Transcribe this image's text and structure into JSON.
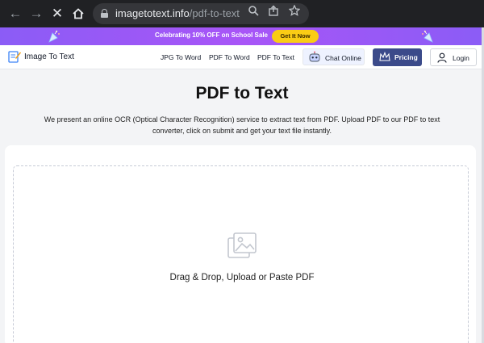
{
  "browser": {
    "url_domain": "imagetotext.info",
    "url_path": "/pdf-to-text",
    "icons": [
      "back-arrow-icon",
      "forward-arrow-icon",
      "close-icon",
      "home-icon",
      "lock-icon",
      "zoom-icon",
      "share-icon",
      "bookmark-star-icon"
    ]
  },
  "promo": {
    "text": "Celebrating 10% OFF on School Sale",
    "cta": "Get It Now",
    "colors": {
      "background": "#a855f7",
      "cta": "#facc15"
    }
  },
  "header": {
    "logo_text": "Image To Text",
    "nav": [
      "JPG To Word",
      "PDF To Word",
      "PDF To Text"
    ],
    "chat_label": "Chat Online",
    "pricing_label": "Pricing",
    "login_label": "Login",
    "colors": {
      "pricing": "#3b4a8a"
    }
  },
  "main": {
    "title": "PDF to Text",
    "description": "We present an online OCR (Optical Character Recognition) service to extract text from PDF. Upload PDF to our PDF to text converter, click on submit and get your text file instantly.",
    "drop_text": "Drag & Drop, Upload or Paste PDF"
  }
}
